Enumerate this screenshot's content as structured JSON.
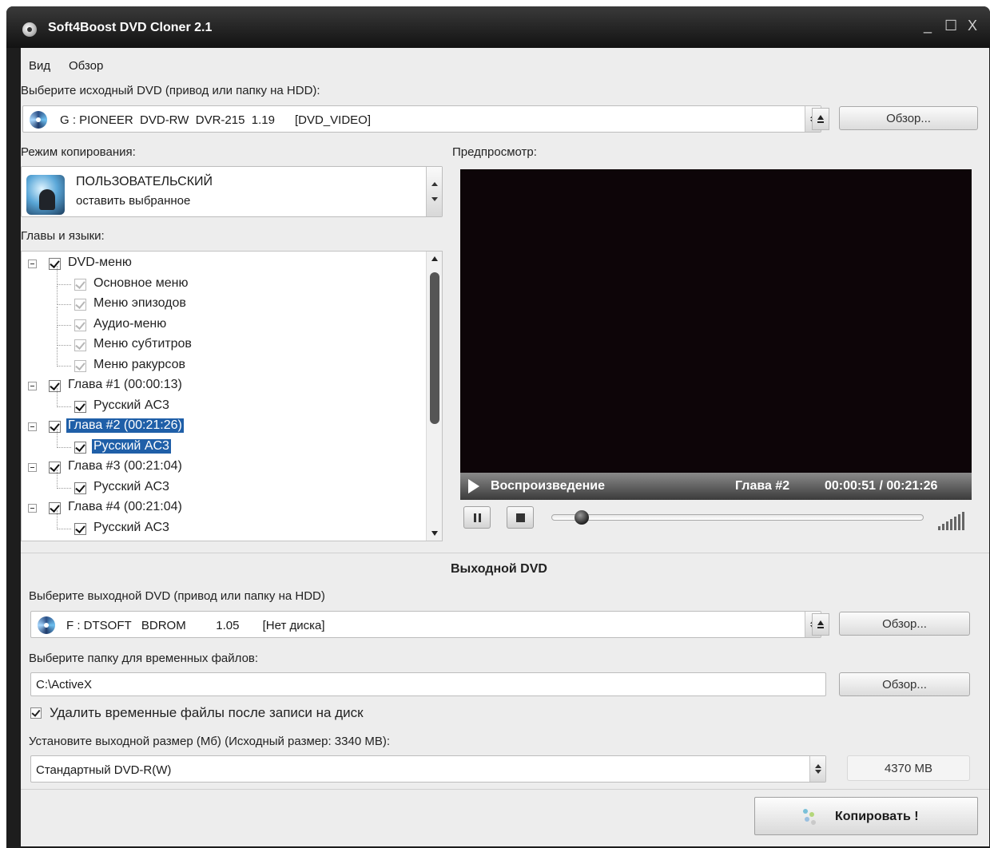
{
  "window": {
    "title": "Soft4Boost DVD Cloner 2.1",
    "controls": {
      "minimize": "_",
      "maximize": "☐",
      "close": "X"
    }
  },
  "menu": {
    "items": [
      "Вид",
      "Обзор"
    ]
  },
  "source": {
    "label": "Выберите исходный DVD (привод или папку на HDD):",
    "drive": "G : PIONEER  DVD-RW  DVR-215  1.19      [DVD_VIDEO]",
    "browse": "Обзор..."
  },
  "copy_mode": {
    "label": "Режим копирования:",
    "title": "ПОЛЬЗОВАТЕЛЬСКИЙ",
    "subtitle": "оставить выбранное"
  },
  "tree": {
    "label": "Главы и языки:",
    "nodes": [
      {
        "label": "DVD-меню",
        "level": 0,
        "checked": true
      },
      {
        "label": "Основное меню",
        "level": 1,
        "checked": true,
        "dim": true
      },
      {
        "label": "Меню эпизодов",
        "level": 1,
        "checked": true,
        "dim": true
      },
      {
        "label": "Аудио-меню",
        "level": 1,
        "checked": true,
        "dim": true
      },
      {
        "label": "Меню субтитров",
        "level": 1,
        "checked": true,
        "dim": true
      },
      {
        "label": "Меню ракурсов",
        "level": 1,
        "checked": true,
        "dim": true
      },
      {
        "label": "Глава #1 (00:00:13)",
        "level": 0,
        "checked": true
      },
      {
        "label": "Русский AC3",
        "level": 1,
        "checked": true
      },
      {
        "label": "Глава #2 (00:21:26)",
        "level": 0,
        "checked": true,
        "selected": true
      },
      {
        "label": "Русский AC3",
        "level": 1,
        "checked": true,
        "selected": true
      },
      {
        "label": "Глава #3 (00:21:04)",
        "level": 0,
        "checked": true
      },
      {
        "label": "Русский AC3",
        "level": 1,
        "checked": true
      },
      {
        "label": "Глава #4 (00:21:04)",
        "level": 0,
        "checked": true
      },
      {
        "label": "Русский AC3",
        "level": 1,
        "checked": true
      }
    ]
  },
  "preview": {
    "label": "Предпросмотр:",
    "status": "Воспроизведение",
    "chapter": "Глава #2",
    "time": "00:00:51 / 00:21:26",
    "position_fraction": 0.04
  },
  "output": {
    "section_title": "Выходной DVD",
    "label": "Выберите выходной DVD (привод или папку на HDD)",
    "drive": "F : DTSOFT   BDROM         1.05       [Нет диска]",
    "browse": "Обзор...",
    "temp_label": "Выберите папку для временных файлов:",
    "temp_path": "C:\\ActiveX",
    "temp_browse": "Обзор...",
    "delete_temp_label": "Удалить временные файлы после записи на диск",
    "delete_temp_checked": true,
    "size_label": "Установите выходной размер (Мб) (Исходный размер: 3340 MB):",
    "size_option": "Стандартный DVD-R(W)",
    "size_value": "4370 MB",
    "copy_button": "Копировать !"
  }
}
